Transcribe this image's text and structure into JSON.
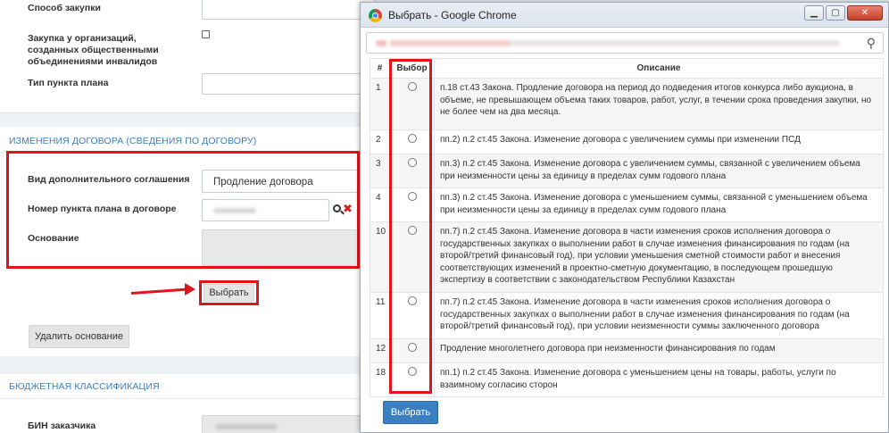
{
  "form": {
    "procurement_method_label": "Способ закупки",
    "disabled_org_label": "Закупка у организаций, созданных общественными объединениями инвалидов",
    "plan_item_type_label": "Тип пункта плана"
  },
  "contract_change": {
    "section_title": "ИЗМЕНЕНИЯ ДОГОВОРА (СВЕДЕНИЯ ПО ДОГОВОРУ)",
    "agreement_type_label": "Вид дополнительного соглашения",
    "agreement_type_value": "Продление договора",
    "plan_item_number_label": "Номер пункта плана в договоре",
    "basis_label": "Основание",
    "select_button": "Выбрать",
    "delete_basis_button": "Удалить основание"
  },
  "budget": {
    "section_title": "БЮДЖЕТНАЯ КЛАССИФИКАЦИЯ",
    "bin_label": "БИН заказчика"
  },
  "popup": {
    "window_title": "Выбрать - Google Chrome",
    "table": {
      "columns": [
        "#",
        "Выбор",
        "Описание"
      ],
      "rows": [
        {
          "num": "1",
          "desc": "п.18 ст.43 Закона. Продление договора на период до подведения итогов конкурса либо аукциона, в объеме, не превышающем объема таких товаров, работ, услуг, в течении срока проведения закупки, но не более чем на два месяца."
        },
        {
          "num": "2",
          "desc": "пп.2) п.2 ст.45 Закона. Изменение договора с увеличением суммы при изменении ПСД"
        },
        {
          "num": "3",
          "desc": "пп.3) п.2 ст.45 Закона. Изменение договора с увеличением суммы, связанной с увеличением объема при неизменности цены за единицу в пределах сумм годового плана"
        },
        {
          "num": "4",
          "desc": "пп.3) п.2 ст.45 Закона. Изменение договора с уменьшением суммы, связанной с уменьшением объема при неизменности цены за единицу в пределах сумм годового плана"
        },
        {
          "num": "10",
          "desc": "пп.7) п.2 ст.45 Закона. Изменение договора в части изменения сроков исполнения договора о государственных закупках о выполнении работ в случае изменения финансирования по годам (на второй/третий финансовый год), при условии  уменьшения сметной стоимости работ и внесения соответствующих изменений в проектно-сметную документацию, в последующем прошедшую экспертизу в соответствии с законодательством Республики Казахстан"
        },
        {
          "num": "11",
          "desc": "пп.7) п.2 ст.45 Закона. Изменение договора в части изменения сроков исполнения договора о государственных закупках о выполнении работ в случае изменения финансирования по годам (на второй/третий финансовый год), при условии неизменности суммы заключенного договора"
        },
        {
          "num": "12",
          "desc": "Продление многолетнего договора при неизменности финансирования по годам"
        },
        {
          "num": "18",
          "desc": "пп.1) п.2 ст.45 Закона. Изменение договора с уменьшением цены на товары, работы, услуги по взаимному согласию сторон"
        }
      ]
    },
    "select_button": "Выбрать"
  }
}
